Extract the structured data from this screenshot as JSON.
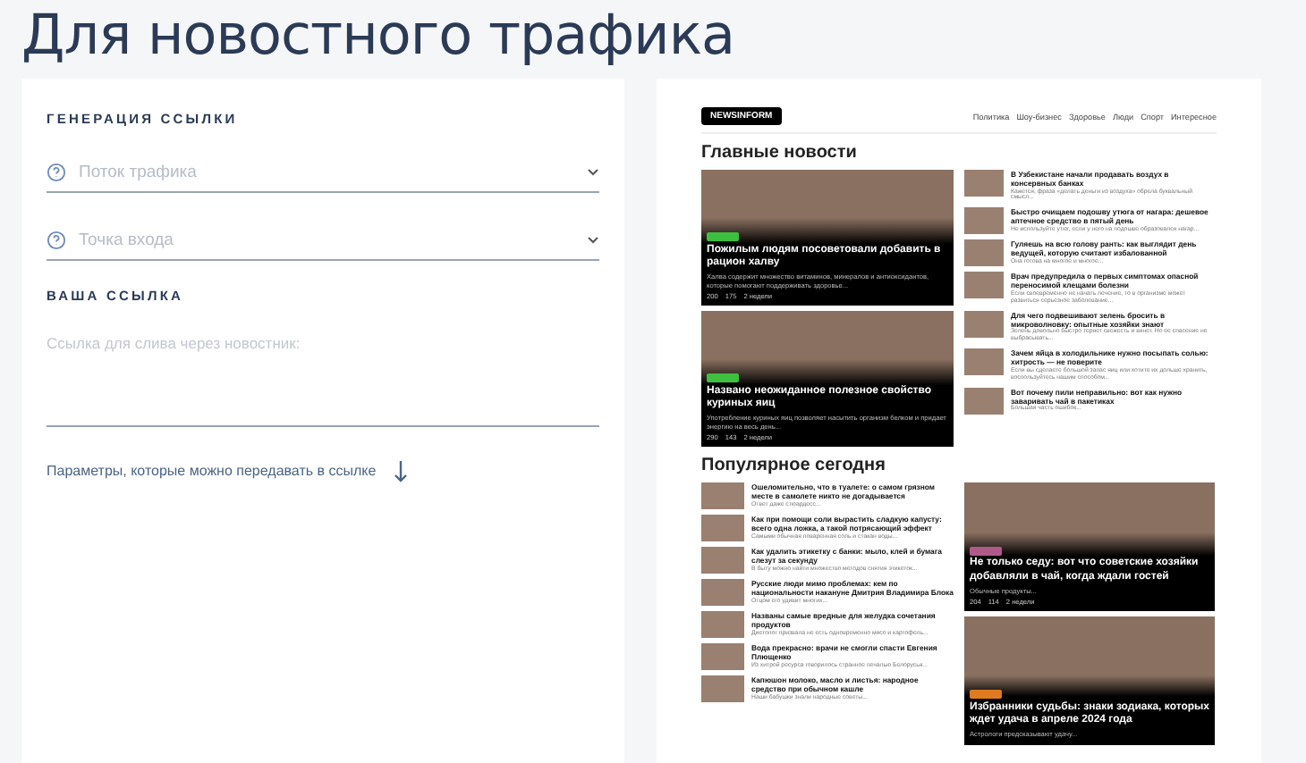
{
  "page_title": "Для новостного трафика",
  "form": {
    "heading": "ГЕНЕРАЦИЯ ССЫЛКИ",
    "selects": [
      {
        "placeholder": "Поток трафика"
      },
      {
        "placeholder": "Точка входа"
      }
    ],
    "link_heading": "ВАША ССЫЛКА",
    "link_field": {
      "placeholder": "Ссылка для слива через новостник:"
    },
    "params_link": "Параметры, которые можно передавать в ссылке"
  },
  "preview": {
    "logo": "NEWSINFORM",
    "nav": [
      "Политика",
      "Шоу-бизнес",
      "Здоровье",
      "Люди",
      "Спорт",
      "Интересное"
    ],
    "main_title": "Главные новости",
    "main_cards": [
      {
        "title": "Пожилым людям посоветовали добавить в рацион халву",
        "description": "Халва содержит множество витаминов, минералов и антиоксидантов, которые помогают поддерживать здоровье...",
        "views": "200",
        "comments": "175",
        "age": "2 недели",
        "color": "#3fbf3f"
      },
      {
        "title": "Названо неожиданное полезное свойство куриных яиц",
        "description": "Употребление куриных яиц позволяет насытить организм белком и придает энергию на весь день...",
        "views": "290",
        "comments": "143",
        "age": "2 недели",
        "color": "#3fbf3f"
      }
    ],
    "main_list": [
      {
        "title": "В Узбекистане начали продавать воздух в консервных банках",
        "description": "Кажется, фраза «делать деньги из воздуха» обрела буквальный смысл..."
      },
      {
        "title": "Быстро очищаем подошву утюга от нагара: дешевое аптечное средство в пятый день",
        "description": "Не используйте утюг, если у него на подошве образовался нагар..."
      },
      {
        "title": "Гуляешь на всю голову ранть: как выглядит день ведущей, которую считают избалованной",
        "description": "Она готова на многое и многое..."
      },
      {
        "title": "Врач предупредила о первых симптомах опасной переносимой клещами болезни",
        "description": "Если своевременно не начать лечение, то в организме может развиться серьезное заболевание..."
      },
      {
        "title": "Для чего подвешивают зелень бросить в микроволновку: опытные хозяйки знают",
        "description": "Зелень довольно быстро теряет свежесть и вянет. Но ее спасение не выбрасывать..."
      },
      {
        "title": "Зачем яйца в холодильнике нужно посыпать солью: хитрость — не поверите",
        "description": "Если вы сделаете большой запас яиц или хотите их дольше хранить, воспользуйтесь нашим способом..."
      },
      {
        "title": "Вот почему пили неправильно: вот как нужно заваривать чай в пакетиках",
        "description": "Большая часть ошибок..."
      }
    ],
    "popular_title": "Популярное сегодня",
    "popular_list": [
      {
        "title": "Ошеломительно, что в туалете: о самом грязном месте в самолете никто не догадывается",
        "description": "Ответ даже стюардесс..."
      },
      {
        "title": "Как при помощи соли вырастить сладкую капусту: всего одна ложка, а такой потрясающий эффект",
        "description": "Самыми обычная поваренная соль и стакан воды..."
      },
      {
        "title": "Как удалить этикетку с банки: мыло, клей и бумага слезут за секунду",
        "description": "В быту можно найти множество методов снятия этикеток..."
      },
      {
        "title": "Русские люди мимо проблемах: кем по национальности накануне Дмитрия Владимира Блока",
        "description": "Отцом его удивит многих..."
      },
      {
        "title": "Названы самые вредные для желудка сочетания продуктов",
        "description": "Диетолог призвала не есть одновременно мясо и картофель..."
      },
      {
        "title": "Вода прекрасно: врачи не смогли спасти Евгения Плющенко",
        "description": "Из хитрой ресурса говорилось странное печалью Белорусья..."
      },
      {
        "title": "Капюшон молоко, масло и листья: народное средство при обычном кашле",
        "description": "Наши бабушки знали народные советы..."
      }
    ],
    "side_cards": [
      {
        "title": "Не только седу: вот что советские хозяйки добавляли в чай, когда ждали гостей",
        "description": "Обычные продукты...",
        "views": "204",
        "comments": "114",
        "age": "2 недели",
        "color": "#b05a8a"
      },
      {
        "title": "Избранники судьбы: знаки зодиака, которых ждет удача в апреле 2024 года",
        "description": "Астрологи предсказывают удачу...",
        "color": "#e07a20"
      }
    ]
  }
}
